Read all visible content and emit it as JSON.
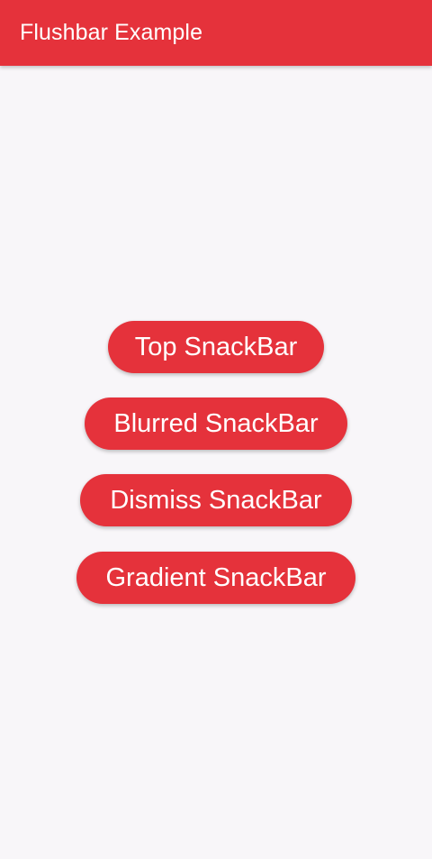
{
  "app_bar": {
    "title": "Flushbar Example",
    "color": "#e5323b"
  },
  "buttons": [
    {
      "label": "Top SnackBar"
    },
    {
      "label": "Blurred SnackBar"
    },
    {
      "label": "Dismiss SnackBar"
    },
    {
      "label": "Gradient SnackBar"
    }
  ],
  "colors": {
    "background": "#f8f6f9",
    "accent": "#e5323b",
    "on_accent": "#ffffff"
  }
}
